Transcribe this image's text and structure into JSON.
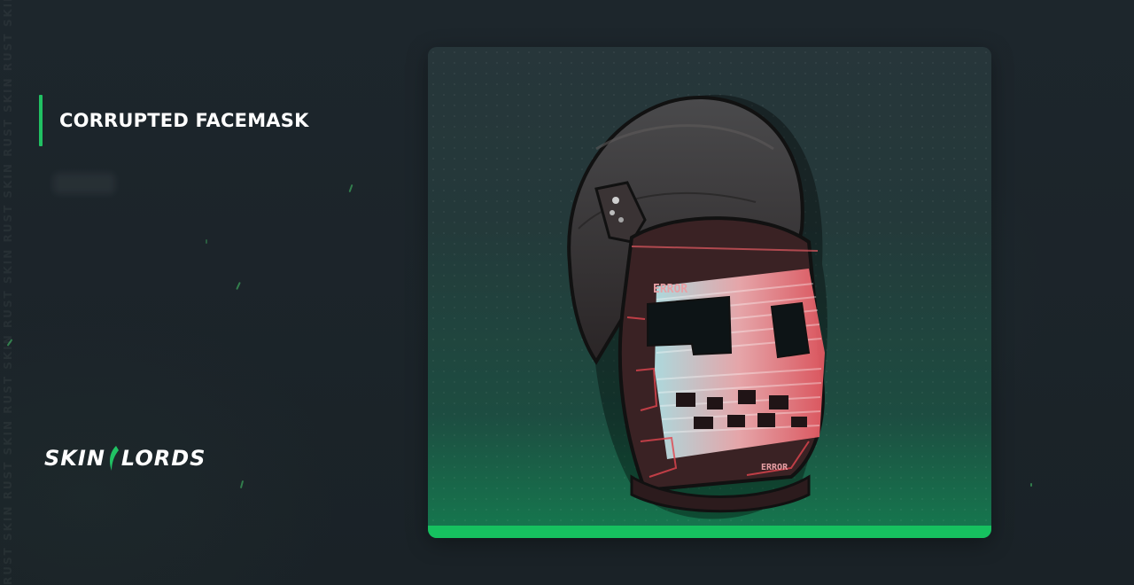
{
  "item": {
    "name": "CORRUPTED FACEMASK"
  },
  "brand": {
    "left": "SKIN",
    "right": "LORDS"
  },
  "watermark": {
    "text": "RUST SKIN RUST SKIN RUST SKIN RUST SKIN RUST SKIN RUST SKIN RUST SKIN RUST SKIN"
  },
  "mask": {
    "top_label": "ERROR",
    "bottom_label": "ERROR"
  },
  "colors": {
    "accent": "#21c163",
    "card_bar": "#16c15f",
    "background": "#1c242a"
  },
  "icons": {
    "title_accent": "accent-bar",
    "product": "facemask-image"
  }
}
